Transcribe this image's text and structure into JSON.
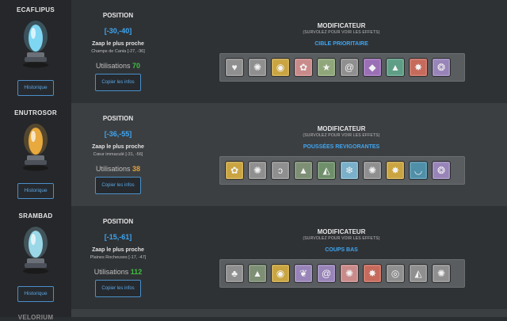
{
  "rows": [
    {
      "name": "ECAFLIPUS",
      "statue_color": "#7fd6f2",
      "history_label": "Historique",
      "position_title": "POSITION",
      "coords": "[-30,-40]",
      "zaap_label": "Zaap le plus proche",
      "zaap_location": "Champs de Cania [-27, -36]",
      "usage_label": "Utilisations",
      "usage_count": "70",
      "usage_color": "#3fbf3f",
      "copy_label": "Copier les infos",
      "modifier_title": "MODIFICATEUR",
      "modifier_hint": "(SURVOLEZ POUR VOIR LES EFFETS)",
      "modifier_name": "CIBLE PRIORITAIRE",
      "icons": [
        {
          "name": "heart-icon",
          "glyph": "♥",
          "color": "#8f8f8f"
        },
        {
          "name": "spiral-icon",
          "glyph": "✺",
          "color": "#8f8f8f"
        },
        {
          "name": "coin-icon",
          "glyph": "◉",
          "color": "#c9a441"
        },
        {
          "name": "flower-icon",
          "glyph": "✿",
          "color": "#c98a8a"
        },
        {
          "name": "star-icon",
          "glyph": "★",
          "color": "#8fa67a"
        },
        {
          "name": "swirl-icon",
          "glyph": "@",
          "color": "#8f8f8f"
        },
        {
          "name": "crystal-icon",
          "glyph": "◆",
          "color": "#9a6fb5"
        },
        {
          "name": "flame-icon",
          "glyph": "▲",
          "color": "#5f9e86"
        },
        {
          "name": "burst-icon",
          "glyph": "✸",
          "color": "#c66a5c"
        },
        {
          "name": "wisp-icon",
          "glyph": "❂",
          "color": "#9884b8"
        }
      ]
    },
    {
      "name": "ENUTROSOR",
      "statue_color": "#e8a93e",
      "history_label": "Historique",
      "position_title": "POSITION",
      "coords": "[-36,-55]",
      "zaap_label": "Zaap le plus proche",
      "zaap_location": "Cœur immaculé [-31, -56]",
      "usage_label": "Utilisations",
      "usage_count": "38",
      "usage_color": "#e6a13a",
      "copy_label": "Copier les infos",
      "modifier_title": "MODIFICATEUR",
      "modifier_hint": "(SURVOLEZ POUR VOIR LES EFFETS)",
      "modifier_name": "POUSSÉES REVIGORANTES",
      "icons": [
        {
          "name": "flower-icon",
          "glyph": "✿",
          "color": "#c9a441"
        },
        {
          "name": "spiral-icon",
          "glyph": "✺",
          "color": "#8f8f8f"
        },
        {
          "name": "ear-icon",
          "glyph": "ↄ",
          "color": "#8f8f8f"
        },
        {
          "name": "shell-icon",
          "glyph": "▲",
          "color": "#7d8f74"
        },
        {
          "name": "mountain-icon",
          "glyph": "◭",
          "color": "#6f8f6a"
        },
        {
          "name": "snowflake-icon",
          "glyph": "❄",
          "color": "#7ab0c9"
        },
        {
          "name": "spiral-icon",
          "glyph": "✺",
          "color": "#8f8f8f"
        },
        {
          "name": "burst-icon",
          "glyph": "✸",
          "color": "#c9a441"
        },
        {
          "name": "wave-icon",
          "glyph": "◡",
          "color": "#4f8fa8"
        },
        {
          "name": "wisp-icon",
          "glyph": "❂",
          "color": "#9884b8"
        }
      ]
    },
    {
      "name": "SRAMBAD",
      "statue_color": "#9ad8e8",
      "history_label": "Historique",
      "position_title": "POSITION",
      "coords": "[-15,-61]",
      "zaap_label": "Zaap le plus proche",
      "zaap_location": "Plaines Rocheuses [-17, -47]",
      "usage_label": "Utilisations",
      "usage_count": "112",
      "usage_color": "#3fbf3f",
      "copy_label": "Copier les infos",
      "modifier_title": "MODIFICATEUR",
      "modifier_hint": "(SURVOLEZ POUR VOIR LES EFFETS)",
      "modifier_name": "COUPS BAS",
      "icons": [
        {
          "name": "tree-icon",
          "glyph": "♣",
          "color": "#8f8f8f"
        },
        {
          "name": "flame-icon",
          "glyph": "▲",
          "color": "#7d8f74"
        },
        {
          "name": "coin-icon",
          "glyph": "◉",
          "color": "#c9a441"
        },
        {
          "name": "feather-icon",
          "glyph": "❦",
          "color": "#9884b8"
        },
        {
          "name": "swirl-icon",
          "glyph": "@",
          "color": "#9884b8"
        },
        {
          "name": "spiral-icon",
          "glyph": "✺",
          "color": "#c98a8a"
        },
        {
          "name": "burst-icon",
          "glyph": "✸",
          "color": "#c66a5c"
        },
        {
          "name": "eye-icon",
          "glyph": "◎",
          "color": "#8f8f8f"
        },
        {
          "name": "mountain-icon",
          "glyph": "◭",
          "color": "#8f8f8f"
        },
        {
          "name": "spiral-icon",
          "glyph": "✺",
          "color": "#8f8f8f"
        }
      ]
    }
  ],
  "next_row_name": "VELORIUM"
}
